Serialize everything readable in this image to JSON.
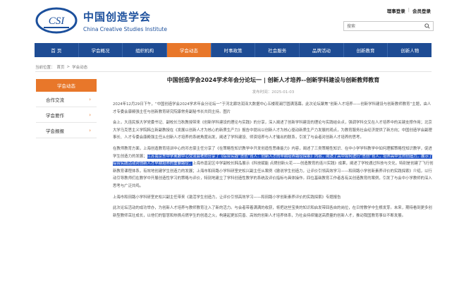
{
  "header": {
    "brand_cn": "中国创造学会",
    "brand_en": "China Creative Studies Institute",
    "logo_icon": "csi-logo-icon",
    "links": {
      "admin": "理事登录",
      "sep": "|",
      "member": "会员登录"
    },
    "search": {
      "placeholder": "搜索"
    }
  },
  "nav": {
    "items": [
      "首 页",
      "学会概况",
      "组织机构",
      "学会动态",
      "时事政策",
      "社会服务",
      "品牌活动",
      "创新教育",
      "创新人物"
    ],
    "active_index": 3
  },
  "breadcrumb": {
    "prefix": "当前位置：",
    "home": "首页",
    "sep": ">",
    "current": "学会动态"
  },
  "sidebar": {
    "title": "学会动态",
    "items": [
      "合作交流",
      "学会要作",
      "学会报报"
    ]
  },
  "article": {
    "title": "中国创造学会2024学术年会分论坛一 | 创新人才培养--创新学科建设与创新教师教育",
    "date": "发布时间：2025-01-03",
    "p1": "2024年12月29日下午，“中国创造学会2024学术年会分论坛一”于河北廊坊润泽大数据中心五楼观澜厅圆满落幕。此次论坛聚焦“创新人才培养——创新学科建设与创新教师教育”主题，由人才专委会康殿强主任与创新教育研究院康常务副秘书长共同主持。图片",
    "p2": "会上，大连民族大学党委书记、副校长马秋教授带来《创新学科建设的理论与实践》的分享，深入阐述了创新学科建设的理论与实践结合点，强调学科交叉在人才培养中的关键支撑作用；北京大学马克思主义学院韩立新副教授在《发展以创新人才为核心的新质生产力》报告中提出以创新人才为核心驱动新质生产力发展的观点，为教育服务社会经济提供了新方向；中国创造学会副理事长、人才专委会康殿强主任从创新人才培养的系统角度出发，阐述了学科建设、师资培养与人才输出的联系，引发了与会者对创新人才培养的思考。",
    "p3_before": "在教师教育方面，上海创造教育培训中心的邓志豪主任分享了《在策略性知识教学中开发创造性思维能力》内容，阐述了三类策略性知识、在中小学学科教学中如何理解策略性知识教学，促进学生创造力的发展；",
    "p3_highlight": "江苏南京东中学奥数中心交流会老师分享了《综合实践“思创”育人：创新人才的早期培养路径探索》内容，阐述了高中如何进行“思创”育人，培养高中生的创造力，展示了综合实践活动对创新人才早期培养的重要路径；",
    "p3_after": "上海市嘉定区中学副校长韩泓展示《科技赋能 点燃创新火花——创造教育的连川实践》成果，阐述了学校通过科技与文化，特别是创建了飞行创新教育课程体系，有效地创建学生创造力的发展；上海市和田路小学科研室史松兴副主任从案例《撤说学生创造力，让评价引领高效学习——和田路小学创新素养评价的实践探索》介绍，以行动引导教师们在教学中开展创造性学习的策略与评价，特别地建立了学科创造性教学的系统及评价指标与具体操作。四位基础教育工作者各有关创造教育的案例，引发了与会中小学教师的深入思考与广泛共鸣。",
    "p4": "上海市和田路小学科研室史松兴副主任带来《激活学生创造力，让评价引领高效学习——和田路小学创新素养评价的实践探索》专题报告",
    "p5": "此次论坛活动的成功举办，为创新人才培养与教师教育注入了新的活力。与会者带着满满的收获，将把这些宝贵的知识和启发带回各自的岗位，在日常教学中生根发芽。未来，期待看到更多创新型教师茁壮成长，以他们的智慧和热情点燃学生的创造之火，构建起更加完善、高效的创新人才培养体系，为社会持续输送高质量的创新人才，推动我国教育事业不断发展。"
  },
  "colors": {
    "nav_bg": "#1e4c94",
    "accent": "#e8772a",
    "highlight": "#2556c9"
  }
}
